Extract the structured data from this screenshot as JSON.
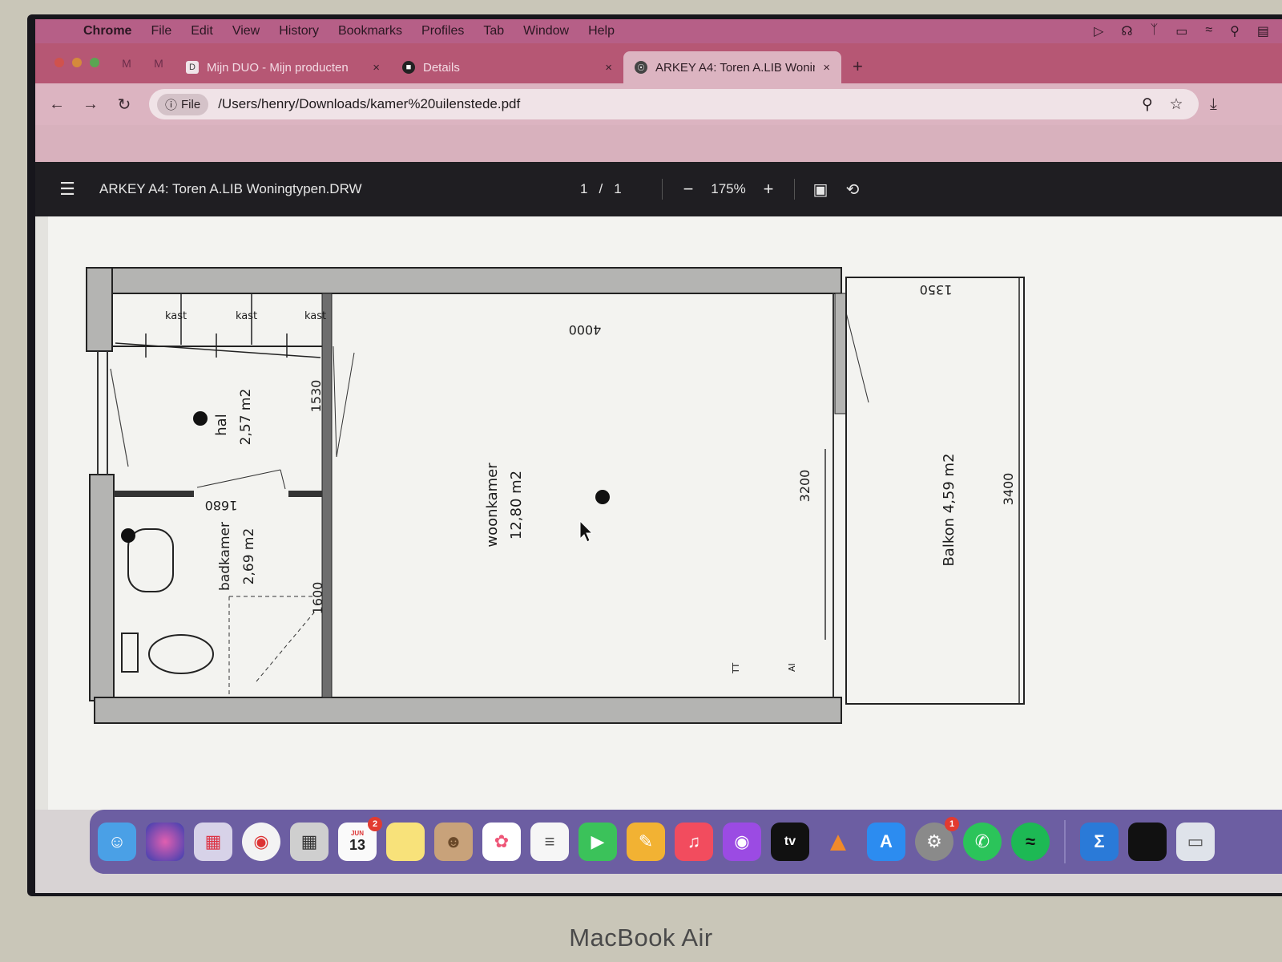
{
  "menubar": {
    "app": "Chrome",
    "items": [
      "File",
      "Edit",
      "View",
      "History",
      "Bookmarks",
      "Profiles",
      "Tab",
      "Window",
      "Help"
    ]
  },
  "tabs": [
    {
      "label": "Mijn DUO - Mijn producten",
      "close": "×"
    },
    {
      "label": "Details",
      "close": "×"
    },
    {
      "label": "ARKEY A4: Toren A.LIB Wonin",
      "close": "×",
      "active": true
    }
  ],
  "new_tab": "+",
  "address": {
    "chip": "File",
    "url": "/Users/henry/Downloads/kamer%20uilenstede.pdf"
  },
  "pdf": {
    "title": "ARKEY A4: Toren A.LIB Woningtypen.DRW",
    "page_current": "1",
    "page_sep": "/",
    "page_total": "1",
    "zoom": "175%"
  },
  "plan": {
    "kast": "kast",
    "hal_name": "hal",
    "hal_area": "2,57 m2",
    "badkamer_name": "badkamer",
    "badkamer_area": "2,69 m2",
    "woonkamer_name": "woonkamer",
    "woonkamer_area": "12,80 m2",
    "balkon": "Balkon 4,59 m2",
    "dim_4000": "4000",
    "dim_1350": "1350",
    "dim_1530": "1530",
    "dim_1680": "1680",
    "dim_1600": "1600",
    "dim_3200": "3200",
    "dim_3400": "3400",
    "label_tt": "TT",
    "label_ai": "AI"
  },
  "dock": {
    "calendar_month": "JUN",
    "calendar_day": "13",
    "calendar_badge": "2",
    "settings_badge": "1",
    "appletv": "tv"
  },
  "device_label": "MacBook Air"
}
